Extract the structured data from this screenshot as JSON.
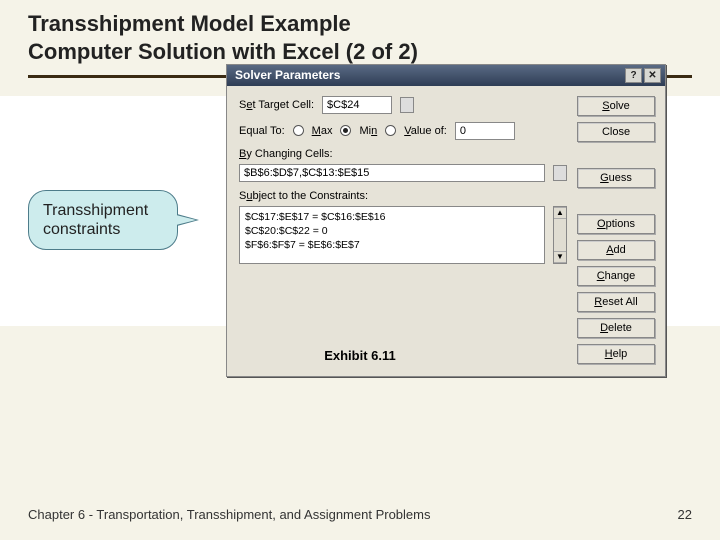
{
  "title_line1": "Transshipment Model Example",
  "title_line2": "Computer Solution with Excel (2 of 2)",
  "callout_text": "Transshipment constraints",
  "dialog": {
    "title": "Solver Parameters",
    "target_label": "Set Target Cell:",
    "target_value": "$C$24",
    "equal_label": "Equal To:",
    "max_label": "Max",
    "min_label": "Min",
    "valueof_label": "Value of:",
    "valueof_value": "0",
    "changing_label": "By Changing Cells:",
    "changing_value": "$B$6:$D$7,$C$13:$E$15",
    "subject_label": "Subject to the Constraints:",
    "constraints": [
      "$C$17:$E$17 = $C$16:$E$16",
      "$C$20:$C$22 = 0",
      "$F$6:$F$7 = $E$6:$E$7"
    ],
    "buttons": {
      "solve": "Solve",
      "close": "Close",
      "guess": "Guess",
      "options": "Options",
      "add": "Add",
      "change": "Change",
      "delete": "Delete",
      "resetall": "Reset All",
      "help": "Help"
    }
  },
  "exhibit": "Exhibit 6.11",
  "footer_text": "Chapter 6 - Transportation, Transshipment, and Assignment Problems",
  "page_number": "22"
}
